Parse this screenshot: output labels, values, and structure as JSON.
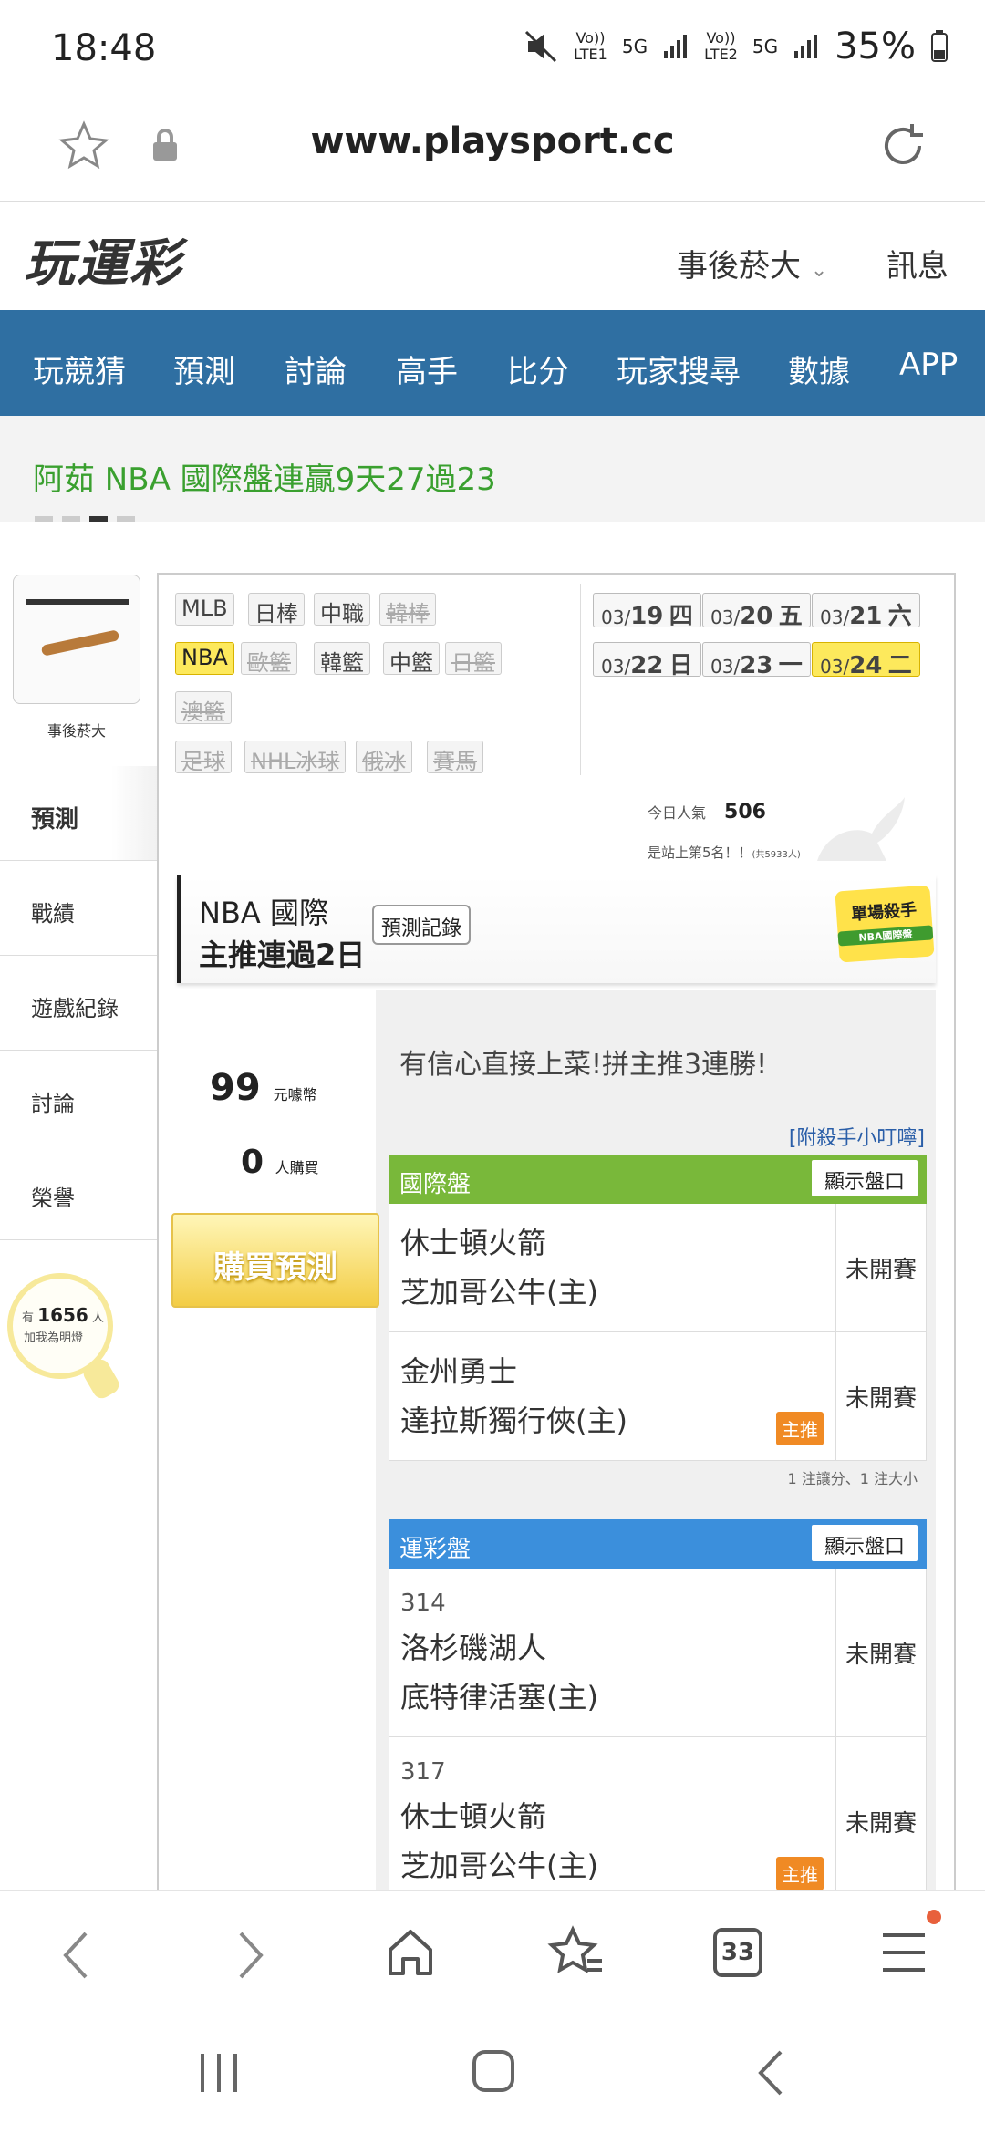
{
  "status": {
    "time": "18:48",
    "battery": "35%",
    "net1": "5G",
    "net2": "5G",
    "lte1": "LTE1",
    "lte2": "LTE2",
    "vo": "Vo))"
  },
  "browser": {
    "url": "www.playsport.cc"
  },
  "site": {
    "logo": "玩運彩",
    "user": "事後菸大",
    "messages": "訊息"
  },
  "nav": [
    "玩競猜",
    "預測",
    "討論",
    "高手",
    "比分",
    "玩家搜尋",
    "數據",
    "APP"
  ],
  "marquee": {
    "text": "阿茹 NBA 國際盤連贏9天27過23"
  },
  "profile": {
    "name": "事後菸大"
  },
  "sidebar": [
    "預測",
    "戰績",
    "遊戲紀錄",
    "討論",
    "榮譽"
  ],
  "fans": {
    "prefix": "有",
    "count": "1656",
    "unit": "人",
    "label": "加我為明燈"
  },
  "leagues": [
    {
      "label": "MLB",
      "state": "normal"
    },
    {
      "label": "日棒",
      "state": "normal"
    },
    {
      "label": "中職",
      "state": "normal"
    },
    {
      "label": "韓棒",
      "state": "disabled"
    },
    {
      "label": "NBA",
      "state": "selected"
    },
    {
      "label": "歐籃",
      "state": "disabled"
    },
    {
      "label": "韓籃",
      "state": "normal"
    },
    {
      "label": "中籃",
      "state": "normal"
    },
    {
      "label": "日籃",
      "state": "disabled"
    },
    {
      "label": "澳籃",
      "state": "disabled"
    },
    {
      "label": "足球",
      "state": "disabled"
    },
    {
      "label": "NHL冰球",
      "state": "disabled"
    },
    {
      "label": "俄冰",
      "state": "disabled"
    },
    {
      "label": "賽馬",
      "state": "disabled"
    }
  ],
  "dates": [
    {
      "md": "03/",
      "day": "19",
      "wd": "四",
      "selected": false
    },
    {
      "md": "03/",
      "day": "20",
      "wd": "五",
      "selected": false
    },
    {
      "md": "03/",
      "day": "21",
      "wd": "六",
      "selected": false
    },
    {
      "md": "03/",
      "day": "22",
      "wd": "日",
      "selected": false
    },
    {
      "md": "03/",
      "day": "23",
      "wd": "一",
      "selected": false
    },
    {
      "md": "03/",
      "day": "24",
      "wd": "二",
      "selected": true
    }
  ],
  "popularity": {
    "label": "今日人氣",
    "value": "506",
    "rank": "是站上第5名！！",
    "total": "(共5933人)"
  },
  "expert": {
    "line1": "NBA 國際",
    "line2": "主推連過2日",
    "records_button": "預測記錄",
    "badge_title": "單場殺手",
    "badge_sub": "NBA國際盤"
  },
  "predict": {
    "price": "99",
    "price_unit": "元噱幣",
    "buyers": "0",
    "buyers_unit": "人購買",
    "buy_button": "購買預測",
    "message": "有信心直接上菜!拼主推3連勝!",
    "tip": "[附殺手小叮嚀]"
  },
  "intl_table": {
    "title": "國際盤",
    "show_label": "顯示盤口",
    "rows": [
      {
        "away": "休士頓火箭",
        "home": "芝加哥公牛(主)",
        "status": "未開賽",
        "main": ""
      },
      {
        "away": "金州勇士",
        "home": "達拉斯獨行俠(主)",
        "status": "未開賽",
        "main": "主推"
      }
    ],
    "note": "1 注讓分、1 注大小"
  },
  "sport_table": {
    "title": "運彩盤",
    "show_label": "顯示盤口",
    "rows": [
      {
        "code": "314",
        "away": "洛杉磯湖人",
        "home": "底特律活塞(主)",
        "status": "未開賽",
        "main": ""
      },
      {
        "code": "317",
        "away": "休士頓火箭",
        "home": "芝加哥公牛(主)",
        "status": "未開賽",
        "main": "主推"
      }
    ]
  },
  "bottombar": {
    "tabs_count": "33"
  },
  "colors": {
    "nav": "#2f6fa2",
    "intl": "#79b83a",
    "sport": "#3b8fdc",
    "marquee": "#3aa02f",
    "highlight": "#fde95c"
  }
}
